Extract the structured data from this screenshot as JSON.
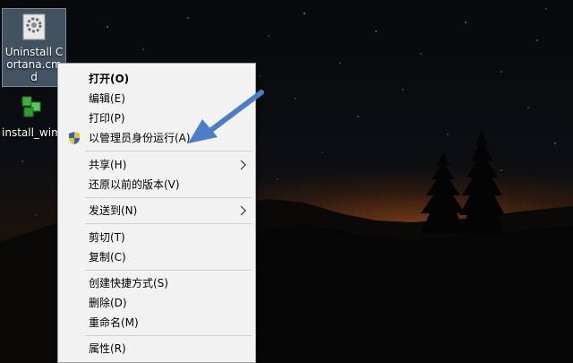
{
  "desktop": {
    "icons": [
      {
        "label": "Uninstall Cortana.cmd",
        "icon": "settings-gear-file-icon"
      },
      {
        "label": "install_wim",
        "icon": "green-cubes-icon"
      }
    ]
  },
  "context_menu": {
    "items": [
      {
        "label": "打开(O)",
        "bold": true
      },
      {
        "label": "编辑(E)"
      },
      {
        "label": "打印(P)"
      },
      {
        "label": "以管理员身份运行(A)",
        "icon": "uac-shield-icon"
      },
      {
        "label": "共享(H)",
        "submenu": true
      },
      {
        "label": "还原以前的版本(V)"
      },
      {
        "label": "发送到(N)",
        "submenu": true
      },
      {
        "label": "剪切(T)"
      },
      {
        "label": "复制(C)"
      },
      {
        "label": "创建快捷方式(S)"
      },
      {
        "label": "删除(D)"
      },
      {
        "label": "重命名(M)"
      },
      {
        "label": "属性(R)"
      }
    ]
  },
  "annotation": {
    "arrow_color": "#4a7fc8"
  },
  "colors": {
    "menu_bg": "#f2f2f2",
    "selection": "#8caac8"
  }
}
